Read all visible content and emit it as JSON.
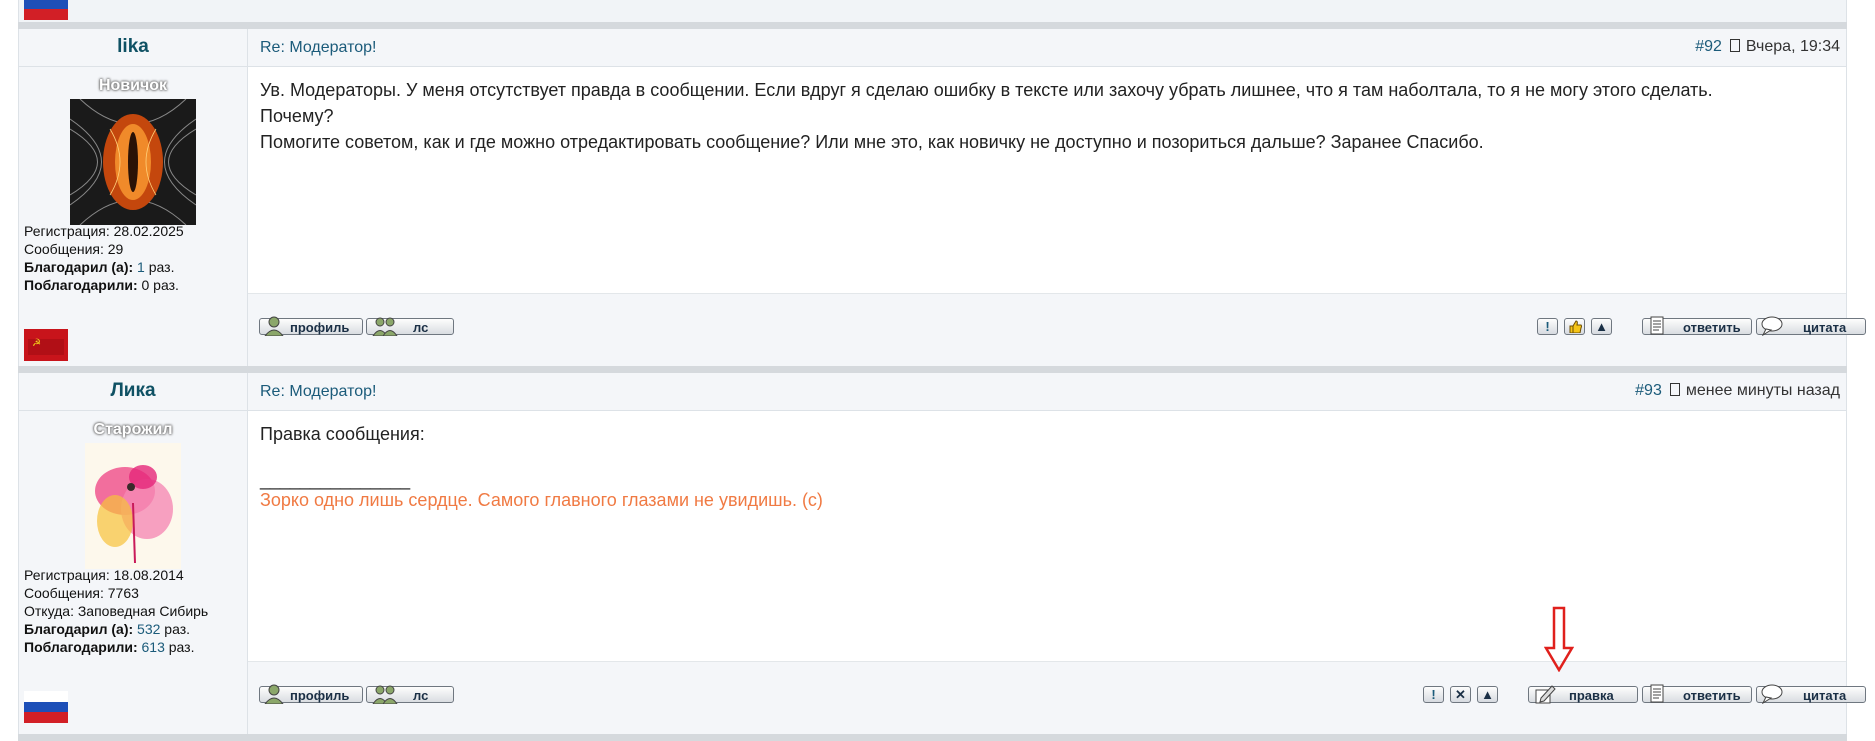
{
  "posts": [
    {
      "nick": "lika",
      "topic": "Re: Модератор!",
      "number": "#92",
      "time": "Вчера, 19:34",
      "rank": "Новичок",
      "reg": "Регистрация: 28.02.2025",
      "msgs": "Сообщения: 29",
      "thanked_label": "Благодарил (а):",
      "thanked_count": "1",
      "thanked_suffix": "раз.",
      "thanks_label": "Поблагодарили:",
      "thanks_count": "0 раз.",
      "body_lines": [
        "Ув. Модераторы. У меня отсутствует правда в сообщении. Если вдруг я сделаю ошибку в тексте или захочу убрать лишнее, что я там наболтала, то я не могу этого сделать.",
        "Почему?",
        "Помогите советом, как и где можно отредактировать сообщение? Или мне это, как новичку не доступно и позориться дальше? Заранее Спасибо."
      ]
    },
    {
      "nick": "Лика",
      "topic": "Re: Модератор!",
      "number": "#93",
      "time": "менее минуты назад",
      "rank": "Старожил",
      "reg": "Регистрация: 18.08.2014",
      "msgs": "Сообщения: 7763",
      "from": "Откуда: Заповедная Сибирь",
      "thanked_label": "Благодарил (а):",
      "thanked_count": "532",
      "thanked_suffix": "раз.",
      "thanks_label": "Поблагодарили:",
      "thanks_count": "613",
      "thanks_suffix": "раз.",
      "body_line": "Правка сообщения:",
      "signature_rule": "_______________",
      "signature": "Зорко одно лишь сердце. Самого главного глазами не увидишь. (c)"
    }
  ],
  "buttons": {
    "profile": "профиль",
    "pm": "лс",
    "reply": "ответить",
    "quote": "цитата",
    "edit": "правка",
    "report": "!",
    "delete": "✕",
    "up": "▲"
  },
  "colors": {
    "link": "#1b5b7a",
    "signature": "#f07a43",
    "arrow": "#e0201c"
  }
}
